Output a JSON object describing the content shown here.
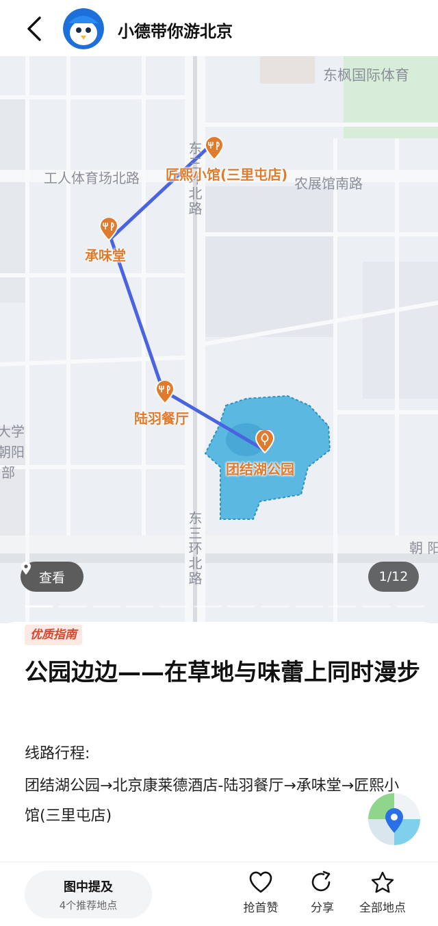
{
  "header": {
    "title": "小德带你游北京"
  },
  "map": {
    "labels": {
      "stadium": "东枫国际体育",
      "gongti_road": "工人体育场北路",
      "nongzhan_road": "农展馆南路",
      "east_ring_upper": "东三环北路",
      "east_ring_lower": "东三环北路",
      "university": "大学",
      "chaoyang": "朝阳",
      "bu": "部",
      "chaoyang_right": "朝 阳"
    },
    "pois": [
      {
        "name": "匠熙小馆(三里屯店)",
        "icon": "restaurant-icon"
      },
      {
        "name": "承味堂",
        "icon": "restaurant-icon"
      },
      {
        "name": "陆羽餐厅",
        "icon": "restaurant-icon"
      },
      {
        "name": "团结湖公园",
        "icon": "park-icon"
      }
    ],
    "view_button": "查看",
    "counter": "1/12",
    "current_slide": 1,
    "total_slides": 12
  },
  "post": {
    "badge": "优质指南",
    "title": "公园边边——在草地与味蕾上同时漫步",
    "route_label": "线路行程:",
    "route_text": "团结湖公园→北京康莱德酒店-陆羽餐厅→承味堂→匠熙小馆(三里屯店)"
  },
  "bottom_bar": {
    "mention_title": "图中提及",
    "mention_sub": "4个推荐地点",
    "like": "抢首赞",
    "share": "分享",
    "all_places": "全部地点"
  },
  "colors": {
    "route": "#4a63e0",
    "poi": "#e07b2e",
    "park": "#5bb8e0",
    "badge": "#d9462e"
  }
}
